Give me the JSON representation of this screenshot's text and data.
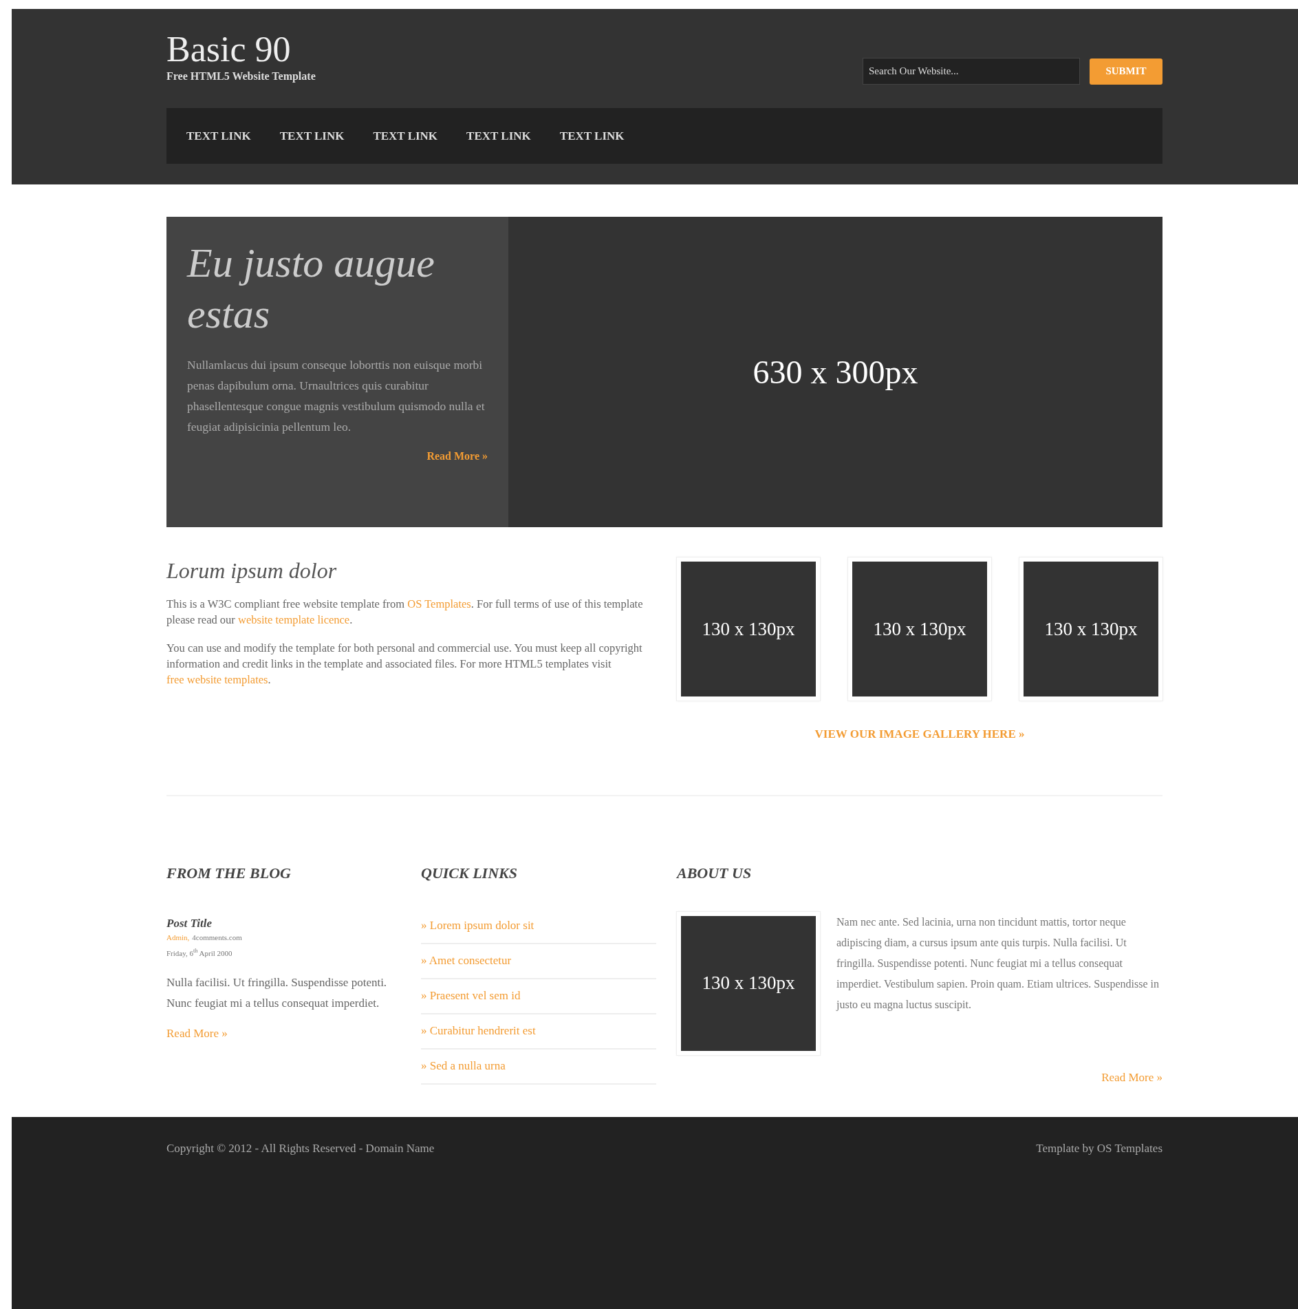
{
  "header": {
    "title": "Basic 90",
    "tagline": "Free HTML5 Website Template",
    "search": {
      "placeholder": "Search Our Website..."
    },
    "submit": "SUBMIT"
  },
  "nav": [
    {
      "label": "TEXT LINK"
    },
    {
      "label": "TEXT LINK"
    },
    {
      "label": "TEXT LINK"
    },
    {
      "label": "TEXT LINK"
    },
    {
      "label": "TEXT LINK"
    }
  ],
  "hero": {
    "title": "Eu justo augue estas",
    "text": "Nullamlacus dui ipsum conseque loborttis non euisque morbi penas dapibulum orna. Urnaultrices quis curabitur phasellentesque congue magnis vestibulum quismodo nulla et feugiat adipisicinia pellentum leo.",
    "read_more": "Read More »",
    "image_label": "630 x 300px"
  },
  "intro": {
    "title": "Lorum ipsum dolor",
    "paragraphs": [
      [
        {
          "text": "This is a W3C compliant free website template from "
        },
        {
          "text": "OS Templates",
          "link": true
        },
        {
          "text": ". For full terms of use of this template please read our "
        },
        {
          "text": "website template licence",
          "link": true
        },
        {
          "text": "."
        }
      ],
      [
        {
          "text": "You can use and modify the template for both personal and commercial use. You must keep all copyright information and credit links in the template and associated files. For more HTML5 templates visit "
        },
        {
          "text": "free website templates",
          "link": true
        },
        {
          "text": "."
        }
      ]
    ]
  },
  "gallery": {
    "thumbs": [
      "130 x 130px",
      "130 x 130px",
      "130 x 130px"
    ],
    "link": "VIEW OUR IMAGE GALLERY HERE »"
  },
  "blog": {
    "heading": "FROM THE BLOG",
    "post_title": "Post Title",
    "author": "Admin,",
    "comments": "4comments.com",
    "date": "Friday, 6$^{th}$ April 2000",
    "text": "Nulla facilisi. Ut fringilla. Suspendisse potenti. Nunc feugiat mi a tellus consequat imperdiet.",
    "read_more": "Read More »"
  },
  "quick_links": {
    "heading": "QUICK LINKS",
    "items": [
      "» Lorem ipsum dolor sit",
      "» Amet consectetur",
      "» Praesent vel sem id",
      "» Curabitur hendrerit est",
      "» Sed a nulla urna"
    ]
  },
  "about": {
    "heading": "ABOUT US",
    "image_label": "130 x 130px",
    "text": "Nam nec ante. Sed lacinia, urna non tincidunt mattis, tortor neque adipiscing diam, a cursus ipsum ante quis turpis. Nulla facilisi. Ut fringilla. Suspendisse potenti. Nunc feugiat mi a tellus consequat imperdiet. Vestibulum sapien. Proin quam. Etiam ultrices. Suspendisse in justo eu magna luctus suscipit.",
    "read_more": "Read More »"
  },
  "footer": {
    "copyright": "Copyright © 2012 - All Rights Reserved - Domain Name",
    "credit": "Template by OS Templates"
  }
}
